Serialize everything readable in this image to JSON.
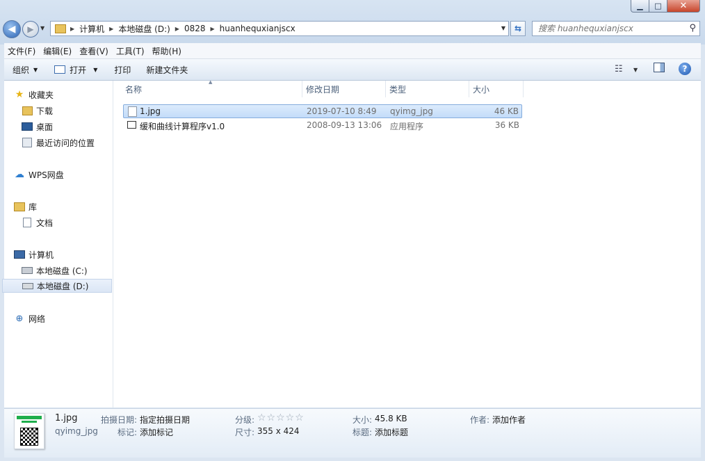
{
  "window": {
    "minimize": "▁",
    "maximize": "□",
    "close": "✕"
  },
  "address": {
    "crumbs": [
      "计算机",
      "本地磁盘 (D:)",
      "0828",
      "huanhequxianjscx"
    ]
  },
  "search": {
    "placeholder": "搜索 huanhequxianjscx"
  },
  "menu": {
    "items": [
      "文件(F)",
      "编辑(E)",
      "查看(V)",
      "工具(T)",
      "帮助(H)"
    ]
  },
  "toolbar": {
    "organize": "组织",
    "open": "打开",
    "print": "打印",
    "new_folder": "新建文件夹"
  },
  "nav": {
    "favorites": "收藏夹",
    "downloads": "下载",
    "desktop": "桌面",
    "recent": "最近访问的位置",
    "wps": "WPS网盘",
    "library": "库",
    "documents": "文档",
    "computer": "计算机",
    "drive_c": "本地磁盘 (C:)",
    "drive_d": "本地磁盘 (D:)",
    "network": "网络"
  },
  "columns": {
    "name": "名称",
    "modified": "修改日期",
    "type": "类型",
    "size": "大小"
  },
  "files": [
    {
      "name": "1.jpg",
      "modified": "2019-07-10 8:49",
      "type": "qyimg_jpg",
      "size": "46 KB",
      "selected": true
    },
    {
      "name": "缓和曲线计算程序v1.0",
      "modified": "2008-09-13 13:06",
      "type": "应用程序",
      "size": "36 KB",
      "selected": false
    }
  ],
  "details": {
    "filename": "1.jpg",
    "filetype": "qyimg_jpg",
    "date_taken_label": "拍摄日期:",
    "date_taken_value": "指定拍摄日期",
    "tags_label": "标记:",
    "tags_value": "添加标记",
    "rating_label": "分级:",
    "rating_stars": "☆☆☆☆☆",
    "dimensions_label": "尺寸:",
    "dimensions_value": "355 x 424",
    "size_label": "大小:",
    "size_value": "45.8 KB",
    "title_label": "标题:",
    "title_value": "添加标题",
    "author_label": "作者:",
    "author_value": "添加作者"
  },
  "colors": {
    "selection": "#cde2fb",
    "frame": "#dbe5f1",
    "link_blue": "#1d57b0"
  }
}
